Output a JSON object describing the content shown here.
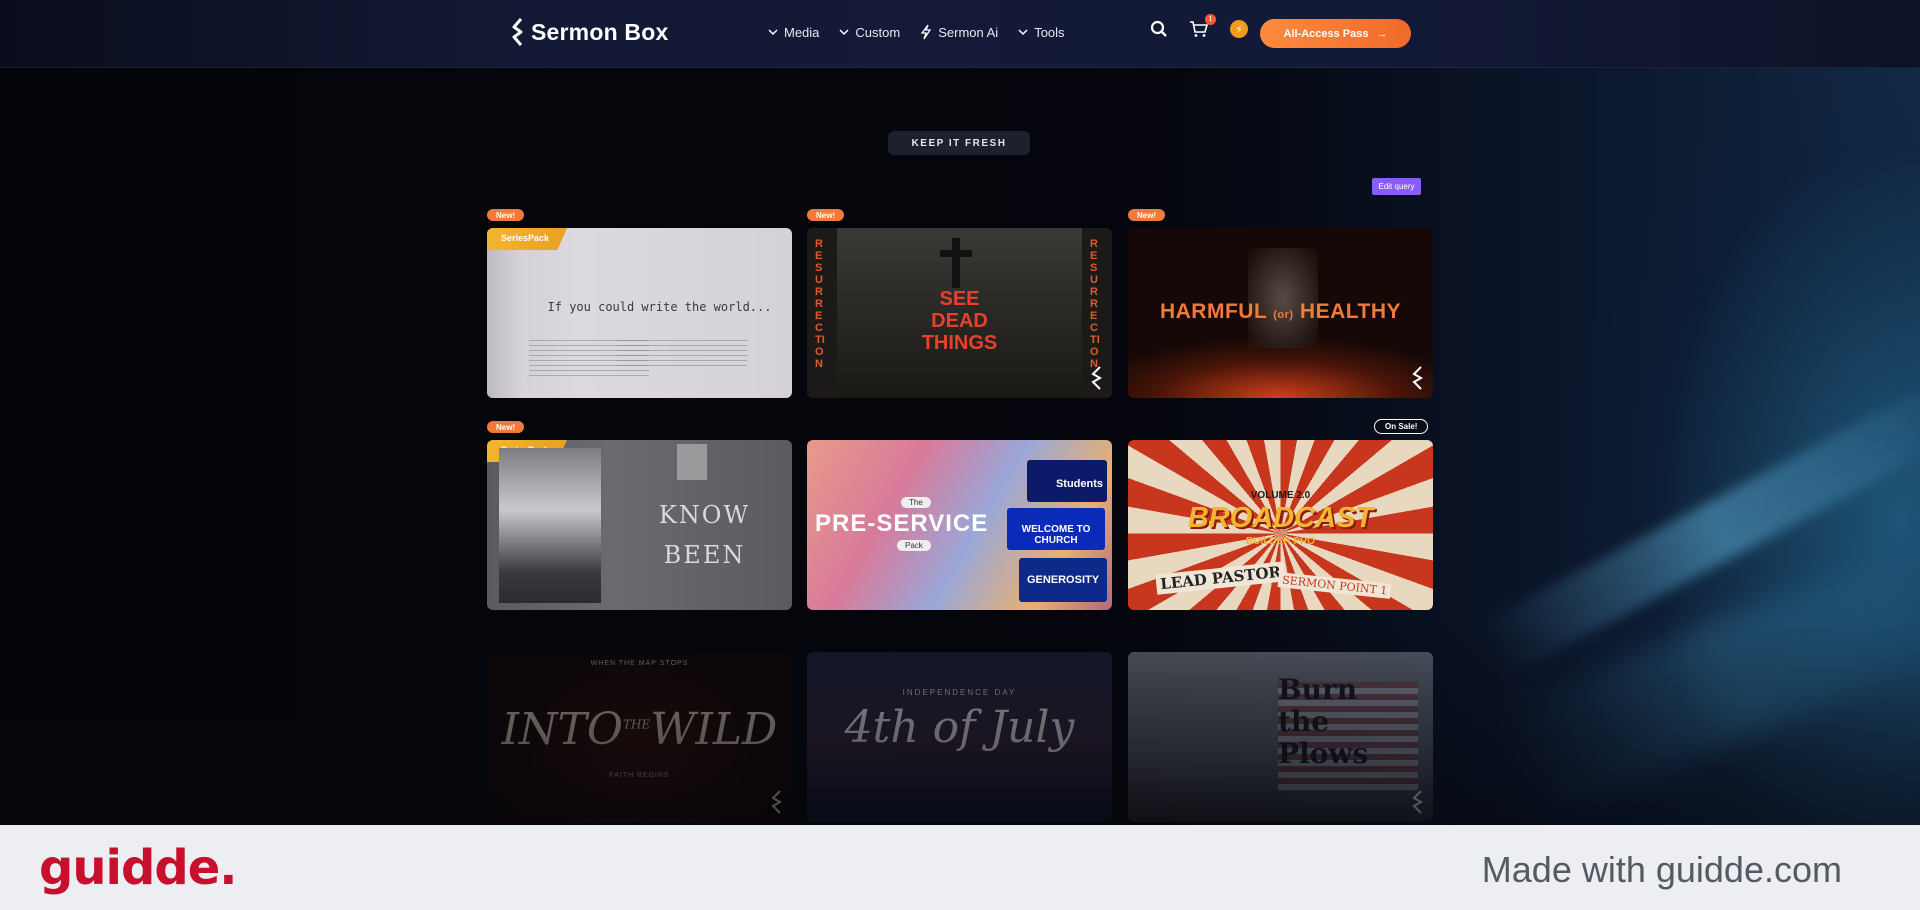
{
  "header": {
    "brand": "Sermon Box",
    "nav": [
      {
        "label": "Media",
        "icon": "chevron-down-icon"
      },
      {
        "label": "Custom",
        "icon": "chevron-down-icon"
      },
      {
        "label": "Sermon Ai",
        "icon": "lightning-icon"
      },
      {
        "label": "Tools",
        "icon": "chevron-down-icon"
      }
    ],
    "cart_count": "1",
    "coin_glyph": "⚡",
    "cta_label": "All-Access Pass",
    "cta_arrow": "→"
  },
  "main": {
    "section_label": "KEEP IT FRESH",
    "edit_query_label": "Edit query",
    "cards": [
      {
        "badge": "New!",
        "corner": "SeriesPack",
        "title": "If you could write the world..."
      },
      {
        "badge": "New!",
        "side_text": "RESURRECTION",
        "title_lines": [
          "SEE",
          "DEAD",
          "THINGS"
        ]
      },
      {
        "badge": "New!",
        "title_left": "HARMFUL",
        "title_mid": "(or)",
        "title_right": "HEALTHY"
      },
      {
        "badge": "New!",
        "corner": "SeriesPack",
        "title_lines": [
          "KNOW",
          "BEEN"
        ]
      },
      {
        "title_small_top": "The",
        "title": "PRE-SERVICE",
        "title_small_bottom": "Pack",
        "tiles": [
          "Students",
          "WELCOME TO CHURCH",
          "GENEROSITY"
        ]
      },
      {
        "badge": "On Sale!",
        "title_top": "VOLUME 2.0",
        "title": "BROADCAST",
        "subtitle": "BUILDER PRO",
        "label_left": "LEAD PASTOR",
        "label_right": "SERMON POINT 1"
      },
      {
        "kicker": "WHEN THE MAP STOPS",
        "title_a": "INTO",
        "title_the": "THE",
        "title_b": "WILD",
        "footer": "FAITH BEGINS"
      },
      {
        "kicker": "INDEPENDENCE DAY",
        "title": "4th of July"
      },
      {
        "title_lines": [
          "Burn",
          "the",
          "Plows"
        ]
      }
    ]
  },
  "footer": {
    "brand": "guidde.",
    "tagline": "Made with guidde.com"
  },
  "colors": {
    "accent": "#f07a3a",
    "edit": "#8a5cf6",
    "brand_red": "#c8102e"
  }
}
